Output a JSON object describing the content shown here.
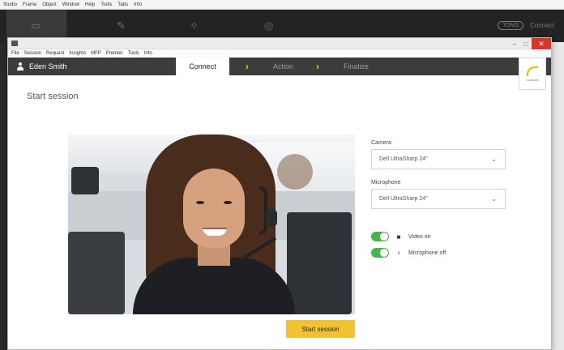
{
  "host": {
    "menu_items": [
      "Studio",
      "Frame",
      "Object",
      "Window",
      "Help",
      "Tools",
      "Tabs",
      "Info"
    ],
    "right_badge": "TOMS",
    "right_label": "Connect",
    "icons": [
      "document-icon",
      "pen-icon",
      "sparkle-icon",
      "check-circle-icon"
    ]
  },
  "window": {
    "menu_items": [
      "File",
      "Session",
      "Request",
      "Insights",
      "MFP",
      "Premier",
      "Tools",
      "Info"
    ],
    "close_symbol": "✕",
    "minimize_symbol": "–",
    "maximize_symbol": "□"
  },
  "nav": {
    "user_name": "Eden Smith",
    "steps": [
      "Connect",
      "Action",
      "Finalize"
    ],
    "active_step": "Connect",
    "logo_text": "Coolcom",
    "accent_color": "#f2c230"
  },
  "content": {
    "title": "Start session",
    "camera_label": "Camera",
    "camera_value": "Dell UltraSharp 24\"",
    "microphone_label": "Microphone",
    "microphone_value": "Dell UltraSharp 24\"",
    "toggle_video_label": "Video on",
    "toggle_mic_label": "Microphone off",
    "start_button": "Start session",
    "toggle_color": "#46b34c"
  }
}
